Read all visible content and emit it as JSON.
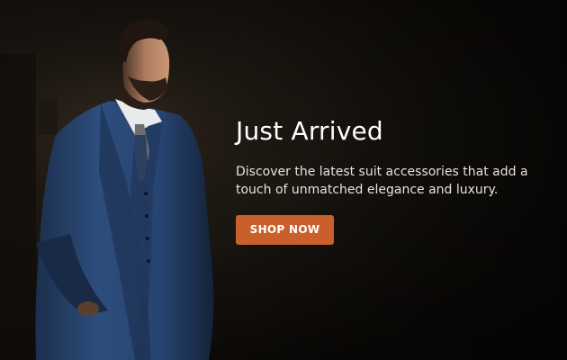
{
  "hero": {
    "image": {
      "subject": "man-in-blue-three-piece-suit",
      "background_color": "#0b0907",
      "suit_color": "#2a4a78"
    },
    "title": "Just Arrived",
    "description": "Discover the latest suit accessories that add a touch of unmatched elegance and luxury.",
    "cta": {
      "label": "SHOP NOW",
      "color": "#c9602c",
      "text_color": "#ffffff"
    }
  }
}
